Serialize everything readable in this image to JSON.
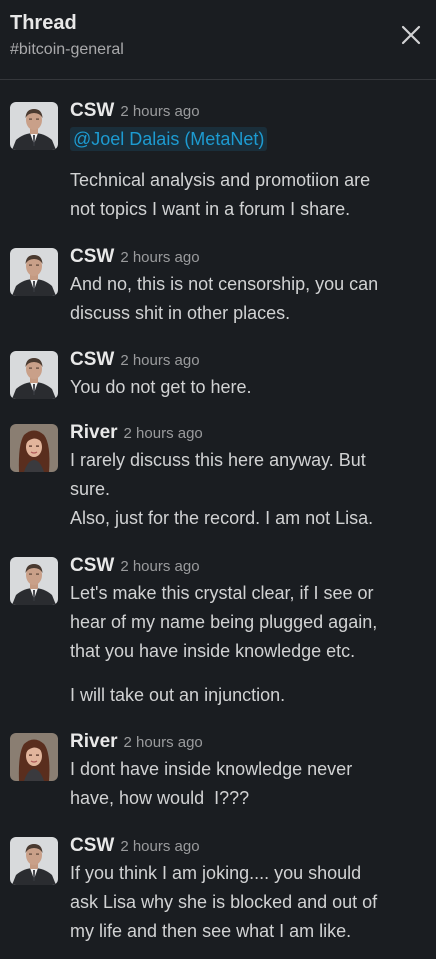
{
  "header": {
    "title": "Thread",
    "channel": "#bitcoin-general"
  },
  "colors": {
    "background": "#1a1d21",
    "text": "#d1d2d3",
    "mention": "#1d9bd1",
    "timestamp": "#9a9b9d"
  },
  "icons": {
    "close": "close-icon",
    "avatar_csw": "man-in-suit-avatar",
    "avatar_river": "woman-avatar"
  },
  "messages": [
    {
      "author": "CSW",
      "time": "2 hours ago",
      "mention": "@Joel Dalais (MetaNet)",
      "lines": [
        "Technical analysis and promotiion are",
        "not topics I want in a forum I share."
      ]
    },
    {
      "author": "CSW",
      "time": "2 hours ago",
      "lines": [
        "And no, this is not censorship, you can",
        "discuss shit in other places."
      ]
    },
    {
      "author": "CSW",
      "time": "2 hours ago",
      "lines": [
        "You do not get to here."
      ]
    },
    {
      "author": "River",
      "time": "2 hours ago",
      "lines": [
        "I rarely discuss this here anyway. But",
        "sure.",
        "Also, just for the record. I am not Lisa."
      ]
    },
    {
      "author": "CSW",
      "time": "2 hours ago",
      "lines": [
        "Let's make this crystal clear, if I see or",
        "hear of my name being plugged again,",
        "that you have inside knowledge etc.",
        "I will take out an injunction."
      ]
    },
    {
      "author": "River",
      "time": "2 hours ago",
      "lines": [
        "I dont have inside knowledge never",
        "have, how would  I???"
      ]
    },
    {
      "author": "CSW",
      "time": "2 hours ago",
      "lines": [
        "If you think I am joking.... you should",
        "ask Lisa why she is blocked and out of",
        "my life and then see what I am like."
      ]
    }
  ]
}
